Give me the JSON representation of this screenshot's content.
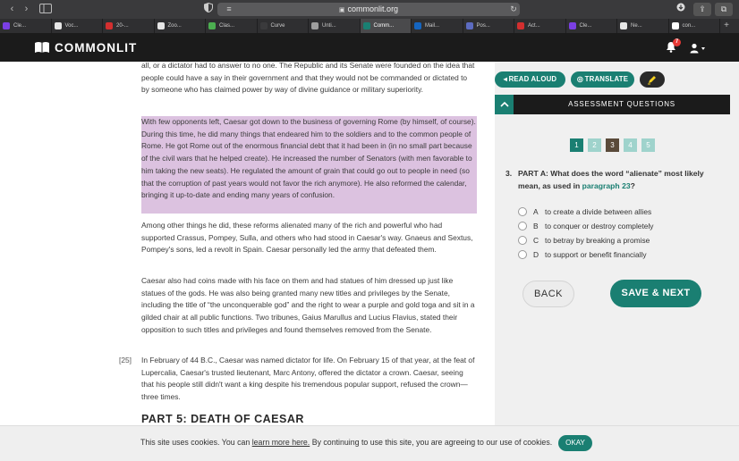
{
  "browser": {
    "url": "commonlit.org",
    "tabs": [
      {
        "label": "Cle...",
        "color": "#7b3fe4"
      },
      {
        "label": "Voc...",
        "color": "#e6e6e6"
      },
      {
        "label": "20-...",
        "color": "#d32f2f"
      },
      {
        "label": "Zoo...",
        "color": "#e6e6e6"
      },
      {
        "label": "Clas...",
        "color": "#4caf50"
      },
      {
        "label": "Curve",
        "color": "#3a3a3c"
      },
      {
        "label": "Unti...",
        "color": "#9e9e9e"
      },
      {
        "label": "Comm...",
        "color": "#1a7f72"
      },
      {
        "label": "Mail...",
        "color": "#1565c0"
      },
      {
        "label": "Pos...",
        "color": "#5c6bc0"
      },
      {
        "label": "Act...",
        "color": "#d32f2f"
      },
      {
        "label": "Cle...",
        "color": "#7b3fe4"
      },
      {
        "label": "Ne...",
        "color": "#e6e6e6"
      },
      {
        "label": "con...",
        "color": "#ffffff"
      }
    ]
  },
  "header": {
    "logo_text": "COMMONLIT",
    "notification_count": "7"
  },
  "article": {
    "p1": "all, or a dictator had to answer to no one. The Republic and its Senate were founded on the idea that people could have a say in their government and that they would not be commanded or dictated to by someone who has claimed power by way of divine guidance or military superiority.",
    "p2": "With few opponents left, Caesar got down to the business of governing Rome (by himself, of course). During this time, he did many things that endeared him to the soldiers and to the common people of Rome. He got Rome out of the enormous financial debt that it had been in (in no small part because of the civil wars that he helped create). He increased the number of Senators (with men favorable to him taking the new seats). He regulated the amount of grain that could go out to people in need (so that the corruption of past years would not favor the rich anymore). He also reformed the calendar, bringing it up-to-date and ending many years of confusion.",
    "p3": "Among other things he did, these reforms alienated many of the rich and powerful who had supported Crassus, Pompey, Sulla, and others who had stood in Caesar's way. Gnaeus and Sextus, Pompey's sons, led a revolt in Spain. Caesar personally led the army that defeated them.",
    "p4": "Caesar also had coins made with his face on them and had statues of him dressed up just like statues of the gods. He was also being granted many new titles and privileges by the Senate, including the title of “the unconquerable god” and the right to wear a purple and gold toga and sit in a gilded chair at all public functions. Two tribunes, Gaius Marullus and Lucius Flavius, stated their opposition to such titles and privileges and found themselves removed from the Senate.",
    "p5_num": "[25]",
    "p5": "In February of 44 B.C., Caesar was named dictator for life. On February 15 of that year, at the feat of Lupercalia, Caesar's trusted lieutenant, Marc Antony, offered the dictator a crown. Caesar, seeing that his people still didn't want a king despite his tremendous popular support, refused the crown—three times.",
    "section_heading": "PART 5: DEATH OF CAESAR"
  },
  "tools": {
    "read_aloud": "READ ALOUD",
    "translate": "TRANSLATE"
  },
  "assessment": {
    "title": "ASSESSMENT QUESTIONS",
    "question_numbers": [
      {
        "label": "1",
        "color": "#1a7f72"
      },
      {
        "label": "2",
        "color": "#9fd3cc"
      },
      {
        "label": "3",
        "color": "#5a4a3a"
      },
      {
        "label": "4",
        "color": "#9fd3cc"
      },
      {
        "label": "5",
        "color": "#9fd3cc"
      }
    ],
    "question_number": "3.",
    "question_prefix": "PART A: What does the word “alienate” most likely mean, as used in",
    "question_link": "paragraph 23",
    "question_suffix": "?",
    "options": [
      {
        "letter": "A",
        "text": "to create a divide between allies"
      },
      {
        "letter": "B",
        "text": "to conquer or destroy completely"
      },
      {
        "letter": "C",
        "text": "to betray by breaking a promise"
      },
      {
        "letter": "D",
        "text": "to support or benefit financially"
      }
    ],
    "back_label": "BACK",
    "save_next_label": "SAVE & NEXT"
  },
  "cookie": {
    "text_before": "This site uses cookies. You can",
    "link": "learn more here.",
    "text_after": "By continuing to use this site, you are agreeing to our use of cookies.",
    "ok_label": "OKAY"
  }
}
